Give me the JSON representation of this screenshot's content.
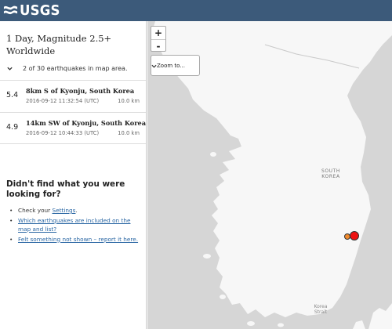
{
  "header": {
    "logo_text": "USGS"
  },
  "sidebar": {
    "title": "1 Day, Magnitude 2.5+ Worldwide",
    "summary": "2 of 30 earthquakes in map area.",
    "earthquakes": [
      {
        "mag": "5.4",
        "place": "8km S of Kyonju, South Korea",
        "time": "2016-09-12 11:32:54 (UTC)",
        "depth": "10.0 km"
      },
      {
        "mag": "4.9",
        "place": "14km SW of Kyonju, South Korea",
        "time": "2016-09-12 10:44:33 (UTC)",
        "depth": "10.0 km"
      }
    ],
    "help": {
      "title": "Didn't find what you were looking for?",
      "items": [
        {
          "prefix": "Check your ",
          "link": "Settings",
          "suffix": "."
        },
        {
          "prefix": "",
          "link": "Which earthquakes are included on the map and list?",
          "suffix": ""
        },
        {
          "prefix": "",
          "link": "Felt something not shown – report it here.",
          "suffix": ""
        }
      ]
    }
  },
  "map": {
    "zoom_in": "+",
    "zoom_out": "-",
    "zoom_to": "Zoom to...",
    "labels": {
      "country_line1": "SOUTH",
      "country_line2": "KOREA",
      "strait_line1": "Korea",
      "strait_line2": "Strait"
    },
    "colors": {
      "land": "#f7f7f7",
      "water": "#d6d6d6",
      "quake_large": "#ee1111",
      "quake_small": "#f08a2c"
    }
  }
}
